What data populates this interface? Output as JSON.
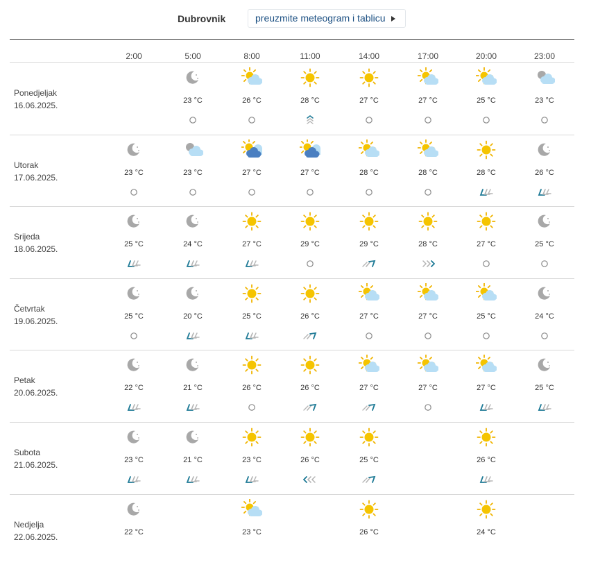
{
  "header": {
    "city": "Dubrovnik",
    "download_label": "preuzmite meteogram i tablicu"
  },
  "hours": [
    "2:00",
    "5:00",
    "8:00",
    "11:00",
    "14:00",
    "17:00",
    "20:00",
    "23:00"
  ],
  "days": [
    {
      "name": "Ponedjeljak",
      "date": "16.06.2025.",
      "slots": [
        null,
        {
          "icon": "moon",
          "temp": "23 °C",
          "wind": "calm"
        },
        {
          "icon": "sun-cloud",
          "temp": "26 °C",
          "wind": "calm"
        },
        {
          "icon": "sun",
          "temp": "28 °C",
          "wind": "up"
        },
        {
          "icon": "sun",
          "temp": "27 °C",
          "wind": "calm"
        },
        {
          "icon": "sun-cloud",
          "temp": "27 °C",
          "wind": "calm"
        },
        {
          "icon": "sun-cloud",
          "temp": "25 °C",
          "wind": "calm"
        },
        {
          "icon": "moon-cloud",
          "temp": "23 °C",
          "wind": "calm"
        }
      ]
    },
    {
      "name": "Utorak",
      "date": "17.06.2025.",
      "slots": [
        {
          "icon": "moon",
          "temp": "23 °C",
          "wind": "calm"
        },
        {
          "icon": "moon-cloud",
          "temp": "23 °C",
          "wind": "calm"
        },
        {
          "icon": "sun-dark-cloud",
          "temp": "27 °C",
          "wind": "calm"
        },
        {
          "icon": "sun-dark-cloud",
          "temp": "27 °C",
          "wind": "calm"
        },
        {
          "icon": "sun-cloud",
          "temp": "28 °C",
          "wind": "calm"
        },
        {
          "icon": "sun-cloud",
          "temp": "28 °C",
          "wind": "calm"
        },
        {
          "icon": "sun",
          "temp": "28 °C",
          "wind": "sw"
        },
        {
          "icon": "moon",
          "temp": "26 °C",
          "wind": "sw"
        }
      ]
    },
    {
      "name": "Srijeda",
      "date": "18.06.2025.",
      "slots": [
        {
          "icon": "moon",
          "temp": "25 °C",
          "wind": "sw"
        },
        {
          "icon": "moon",
          "temp": "24 °C",
          "wind": "sw"
        },
        {
          "icon": "sun",
          "temp": "27 °C",
          "wind": "sw"
        },
        {
          "icon": "sun",
          "temp": "29 °C",
          "wind": "calm"
        },
        {
          "icon": "sun",
          "temp": "29 °C",
          "wind": "ne"
        },
        {
          "icon": "sun",
          "temp": "28 °C",
          "wind": "e"
        },
        {
          "icon": "sun",
          "temp": "27 °C",
          "wind": "calm"
        },
        {
          "icon": "moon",
          "temp": "25 °C",
          "wind": "calm"
        }
      ]
    },
    {
      "name": "Četvrtak",
      "date": "19.06.2025.",
      "slots": [
        {
          "icon": "moon",
          "temp": "25 °C",
          "wind": "calm"
        },
        {
          "icon": "moon",
          "temp": "20 °C",
          "wind": "sw"
        },
        {
          "icon": "sun",
          "temp": "25 °C",
          "wind": "sw"
        },
        {
          "icon": "sun",
          "temp": "26 °C",
          "wind": "ne"
        },
        {
          "icon": "sun-cloud",
          "temp": "27 °C",
          "wind": "calm"
        },
        {
          "icon": "sun-cloud",
          "temp": "27 °C",
          "wind": "calm"
        },
        {
          "icon": "sun-cloud",
          "temp": "25 °C",
          "wind": "calm"
        },
        {
          "icon": "moon",
          "temp": "24 °C",
          "wind": "calm"
        }
      ]
    },
    {
      "name": "Petak",
      "date": "20.06.2025.",
      "slots": [
        {
          "icon": "moon",
          "temp": "22 °C",
          "wind": "sw"
        },
        {
          "icon": "moon",
          "temp": "21 °C",
          "wind": "sw"
        },
        {
          "icon": "sun",
          "temp": "26 °C",
          "wind": "calm"
        },
        {
          "icon": "sun",
          "temp": "26 °C",
          "wind": "ne"
        },
        {
          "icon": "sun-cloud",
          "temp": "27 °C",
          "wind": "ne"
        },
        {
          "icon": "sun-cloud",
          "temp": "27 °C",
          "wind": "calm"
        },
        {
          "icon": "sun-cloud",
          "temp": "27 °C",
          "wind": "sw"
        },
        {
          "icon": "moon",
          "temp": "25 °C",
          "wind": "sw"
        }
      ]
    },
    {
      "name": "Subota",
      "date": "21.06.2025.",
      "slots": [
        {
          "icon": "moon",
          "temp": "23 °C",
          "wind": "sw"
        },
        {
          "icon": "moon",
          "temp": "21 °C",
          "wind": "sw"
        },
        {
          "icon": "sun",
          "temp": "23 °C",
          "wind": "sw"
        },
        {
          "icon": "sun",
          "temp": "26 °C",
          "wind": "w"
        },
        {
          "icon": "sun",
          "temp": "25 °C",
          "wind": "ne"
        },
        null,
        {
          "icon": "sun",
          "temp": "26 °C",
          "wind": "sw"
        },
        null
      ]
    },
    {
      "name": "Nedjelja",
      "date": "22.06.2025.",
      "slots": [
        {
          "icon": "moon",
          "temp": "22 °C",
          "wind": ""
        },
        null,
        {
          "icon": "sun-cloud",
          "temp": "23 °C",
          "wind": ""
        },
        null,
        {
          "icon": "sun",
          "temp": "26 °C",
          "wind": ""
        },
        null,
        {
          "icon": "sun",
          "temp": "24 °C",
          "wind": ""
        },
        null
      ]
    }
  ],
  "colors": {
    "accent": "#1b4f82",
    "sun": "#f5c400",
    "sun_ray": "#f0b400",
    "moon": "#a8a8a8",
    "cloud_light": "#b7def5",
    "cloud_dark": "#4a7fc1",
    "wind_dark": "#1e7a96",
    "wind_light": "#b5b5b5"
  }
}
